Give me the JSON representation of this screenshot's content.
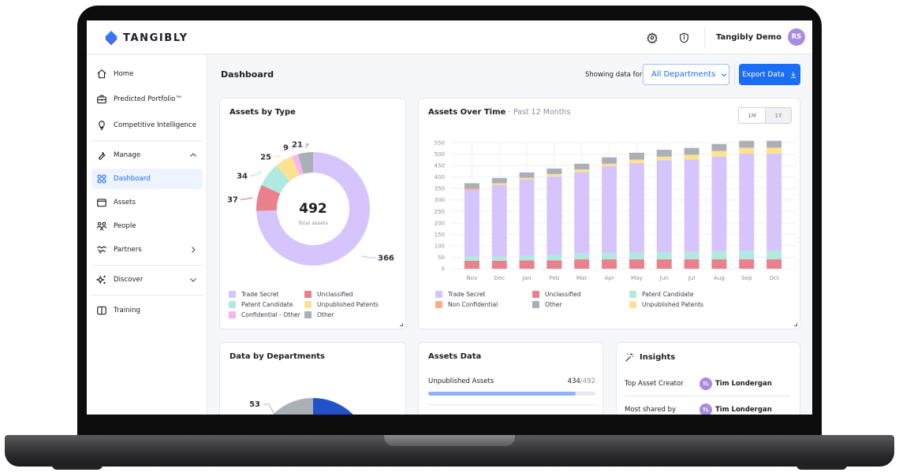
{
  "app": {
    "brand": "TANGIBLY",
    "user_name": "Tangibly Demo",
    "user_initials": "RS"
  },
  "topbar": {
    "icons": [
      "gear-icon",
      "shield-info-icon"
    ]
  },
  "sidebar": {
    "items": [
      {
        "label": "Home",
        "icon": "home-icon"
      },
      {
        "label": "Predicted Portfolio™",
        "icon": "briefcase-icon"
      },
      {
        "label": "Competitive Intelligence",
        "icon": "lightbulb-icon"
      },
      {
        "label": "Manage",
        "icon": "wrench-icon",
        "expanded": true
      },
      {
        "label": "Dashboard",
        "icon": "grid-icon",
        "active": true
      },
      {
        "label": "Assets",
        "icon": "folder-icon"
      },
      {
        "label": "People",
        "icon": "people-icon"
      },
      {
        "label": "Partners",
        "icon": "handshake-icon"
      },
      {
        "label": "Discover",
        "icon": "sparkle-icon",
        "expanded": false
      },
      {
        "label": "Training",
        "icon": "book-icon"
      }
    ]
  },
  "header": {
    "title": "Dashboard",
    "showing_label": "Showing data for",
    "department_selected": "All Departments",
    "export_label": "Export Data"
  },
  "assets_by_type": {
    "title": "Assets by Type",
    "total": "492",
    "total_label": "Total assets"
  },
  "assets_over_time": {
    "title": "Assets Over Time",
    "subtitle": "· Past 12 Months",
    "range_options": [
      "1M",
      "1Y"
    ],
    "range_selected": "1Y"
  },
  "departments": {
    "title": "Data by Departments",
    "visible_label": "53"
  },
  "assets_data": {
    "title": "Assets Data",
    "rows": [
      {
        "label": "Unpublished Assets",
        "value": "434",
        "total": "/492",
        "fraction": 0.882
      }
    ]
  },
  "insights": {
    "title": "Insights",
    "rows": [
      {
        "label": "Top Asset Creator",
        "initials": "TL",
        "name": "Tim Londergan"
      },
      {
        "label": "Most shared by",
        "initials": "TL",
        "name": "Tim Londergan"
      }
    ]
  },
  "colors": {
    "accent": "#1b6ef3",
    "trade_secret": "#d6c5fc",
    "unclassified": "#e9808b",
    "patent_candidate": "#aeeadf",
    "unpublished_patents": "#fde28f",
    "confidential_other": "#f8b4f4",
    "other": "#abb0b7",
    "non_confidential": "#f8b08a",
    "dept_blue": "#2352c8",
    "dept_gray": "#abb0b7"
  },
  "chart_data": [
    {
      "type": "pie",
      "title": "Assets by Type",
      "center_label": "492",
      "center_sublabel": "Total assets",
      "labels": [
        "Trade Secret",
        "Unclassified",
        "Patent Candidate",
        "Unpublished Patents",
        "Confidential - Other",
        "Other"
      ],
      "values": [
        366,
        37,
        34,
        25,
        9,
        21
      ],
      "legend": [
        "Trade Secret",
        "Unclassified",
        "Patent Candidate",
        "Unpublished Patents",
        "Confidential - Other",
        "Other"
      ],
      "legend_position": "bottom"
    },
    {
      "type": "bar",
      "stacked": true,
      "title": "Assets Over Time",
      "categories": [
        "Nov",
        "Dec",
        "Jan",
        "Feb",
        "Mar",
        "Apr",
        "May",
        "Jun",
        "Jul",
        "Aug",
        "Sep",
        "Oct"
      ],
      "ylim": [
        0,
        550
      ],
      "yticks": [
        0,
        50,
        100,
        150,
        200,
        250,
        300,
        350,
        400,
        450,
        500,
        550
      ],
      "grid": true,
      "series": [
        {
          "name": "Unclassified",
          "values": [
            35,
            35,
            37,
            37,
            41,
            41,
            41,
            41,
            41,
            41,
            41,
            41
          ]
        },
        {
          "name": "Patent Candidate",
          "values": [
            18,
            18,
            19,
            23,
            25,
            27,
            30,
            30,
            32,
            35,
            37,
            37
          ]
        },
        {
          "name": "Trade Secret",
          "values": [
            290,
            313,
            334,
            343,
            355,
            380,
            390,
            403,
            404,
            413,
            425,
            425
          ]
        },
        {
          "name": "Non Confidential",
          "values": [
            7,
            0,
            0,
            0,
            0,
            0,
            0,
            0,
            0,
            0,
            0,
            0
          ]
        },
        {
          "name": "Unpublished Patents",
          "values": [
            0,
            7,
            7,
            10,
            12,
            10,
            15,
            15,
            20,
            25,
            25,
            25
          ]
        },
        {
          "name": "Other",
          "values": [
            23,
            23,
            23,
            24,
            25,
            28,
            30,
            30,
            30,
            30,
            30,
            30
          ]
        }
      ],
      "legend": [
        "Trade Secret",
        "Unclassified",
        "Patent Candidate",
        "Non Confidential",
        "Other",
        "Unpublished Patents"
      ],
      "legend_position": "bottom"
    }
  ]
}
